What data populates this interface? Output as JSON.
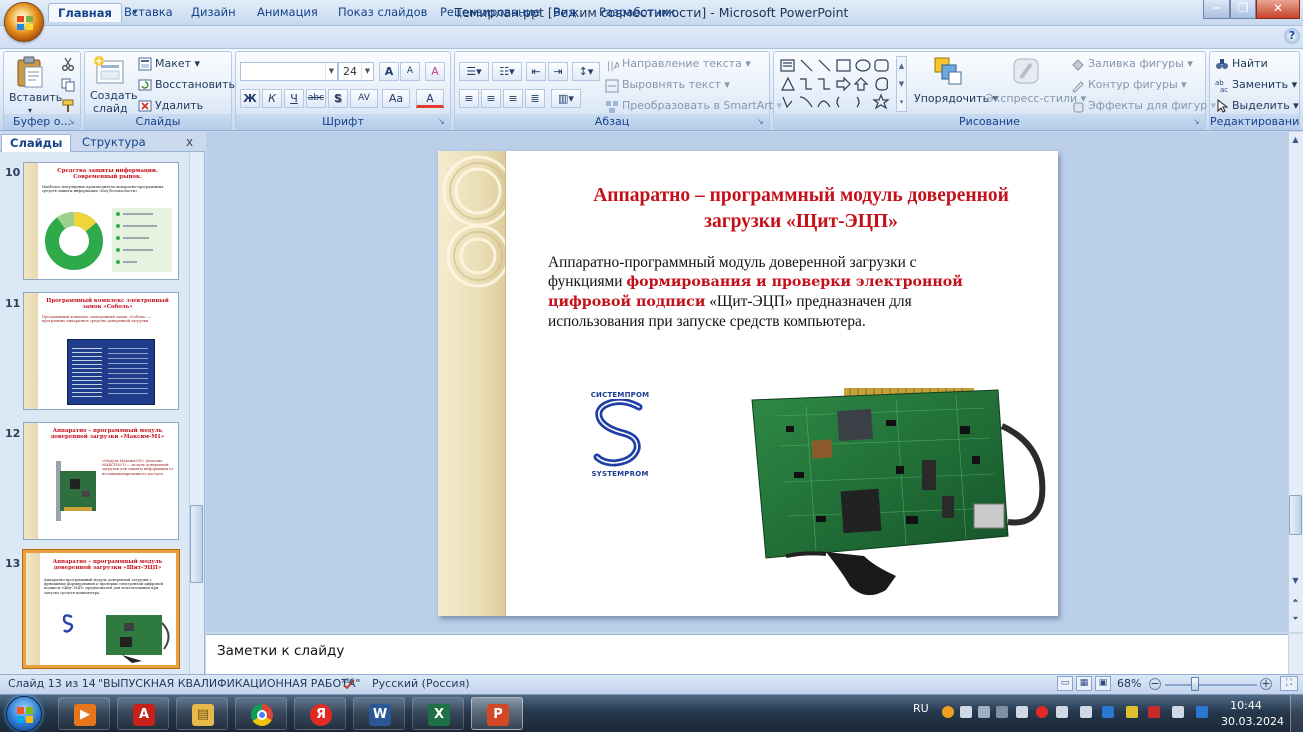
{
  "window": {
    "title": "Темирлан.ppt [Режим совместимости] - Microsoft PowerPoint",
    "minimize": "─",
    "restore": "❐",
    "close": "✕"
  },
  "quick_access": {
    "save": "💾",
    "undo": "↶",
    "redo": "↷",
    "more": "▾"
  },
  "tabs": [
    "Главная",
    "Вставка",
    "Дизайн",
    "Анимация",
    "Показ слайдов",
    "Рецензирование",
    "Вид",
    "Разработчик"
  ],
  "help": "?",
  "ribbon": {
    "clipboard": {
      "label": "Буфер о...",
      "paste": "Вставить",
      "paste_arrow": "▾"
    },
    "slides": {
      "label": "Слайды",
      "create_line1": "Создать",
      "create_line2": "слайд",
      "layout": "Макет",
      "restore": "Восстановить",
      "delete": "Удалить"
    },
    "font": {
      "label": "Шрифт",
      "font_name": "",
      "font_size": "24",
      "grow": "A",
      "shrink": "A",
      "clear": "A",
      "bold": "Ж",
      "italic": "К",
      "underline": "Ч",
      "strike": "abc",
      "shadow": "S",
      "spacing": "AV",
      "case": "Aa",
      "color": "A"
    },
    "paragraph": {
      "label": "Абзац",
      "text_direction": "Направление текста",
      "align_text": "Выровнять текст",
      "smartart": "Преобразовать в SmartArt"
    },
    "drawing": {
      "label": "Рисование",
      "arrange": "Упорядочить",
      "quick_styles": "Экспресс-стили",
      "fill": "Заливка фигуры",
      "outline": "Контур фигуры",
      "effects": "Эффекты для фигур"
    },
    "editing": {
      "label": "Редактирование",
      "find": "Найти",
      "replace": "Заменить",
      "select": "Выделить"
    }
  },
  "panel": {
    "tab_slides": "Слайды",
    "tab_outline": "Структура",
    "close": "x",
    "thumbnails": [
      {
        "number": "10",
        "title": "Средства защиты информации. Современный рынок.",
        "body": "Наиболее популярные производители аппаратно-программных средств защиты информации «Код безопасности»."
      },
      {
        "number": "11",
        "title": "Программный комплекс электронный замок «Соболь»",
        "body": "Программный комплекс электронный замок «Соболь» — программно-аппаратное средство доверенной загрузки."
      },
      {
        "number": "12",
        "title": "Аппаратно – программный модуль доверенной загрузки «Максим-М1»",
        "body": "«Модуль Максим-М1» (изделие МАКСИМ-1) — модуль доверенной загрузки для защиты информации от несанкционированного доступа."
      },
      {
        "number": "13",
        "title": "Аппаратно – программный модуль доверенной загрузки «Щит-ЭЦП»",
        "body": "Аппаратно-программный модуль доверенной загрузки с функциями формирования и проверки электронной цифровой подписи «Щит-ЭЦП» предназначен для использования при запуске средств компьютера."
      }
    ]
  },
  "slide": {
    "title": "Аппаратно – программный модуль доверенной загрузки «Щит-ЭЦП»",
    "body_part1": "Аппаратно-программный модуль доверенной загрузки  с функциями ",
    "body_highlight": "формирования и проверки электронной цифровой подписи",
    "body_part2": "  «Щит-ЭЦП» предназначен для использования при запуске средств компьютера.",
    "logo_top": "СИСТЕМПРОМ",
    "logo_bottom": "SYSTEMPROM"
  },
  "notes": {
    "placeholder": "Заметки к слайду"
  },
  "status": {
    "slide_counter": "Слайд 13 из 14",
    "theme": "\"ВЫПУСКНАЯ КВАЛИФИКАЦИОННАЯ РАБОТА\"",
    "language": "Русский (Россия)",
    "zoom": "68%",
    "zoom_minus": "−",
    "zoom_plus": "+"
  },
  "taskbar": {
    "language": "RU",
    "time": "10:44",
    "date": "30.03.2024",
    "apps": [
      "media-player",
      "acrobat",
      "file-explorer",
      "chrome",
      "yandex-browser",
      "word",
      "excel",
      "powerpoint"
    ],
    "app_glyphs": [
      "▶",
      "A",
      "▤",
      "",
      "Я",
      "W",
      "X",
      "P"
    ]
  }
}
